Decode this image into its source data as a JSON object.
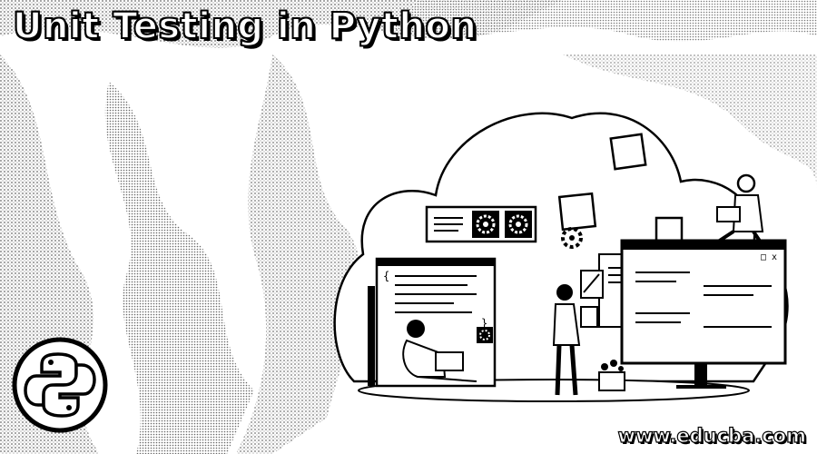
{
  "banner": {
    "title": "Unit Testing in Python",
    "website": "www.educba.com"
  },
  "icons": {
    "logo": "python-logo-icon",
    "illustration": "cloud-testing-illustration",
    "gears": "gear-icon"
  },
  "colors": {
    "ink": "#000000",
    "paper": "#ffffff",
    "texture": "#9a9a9a"
  }
}
